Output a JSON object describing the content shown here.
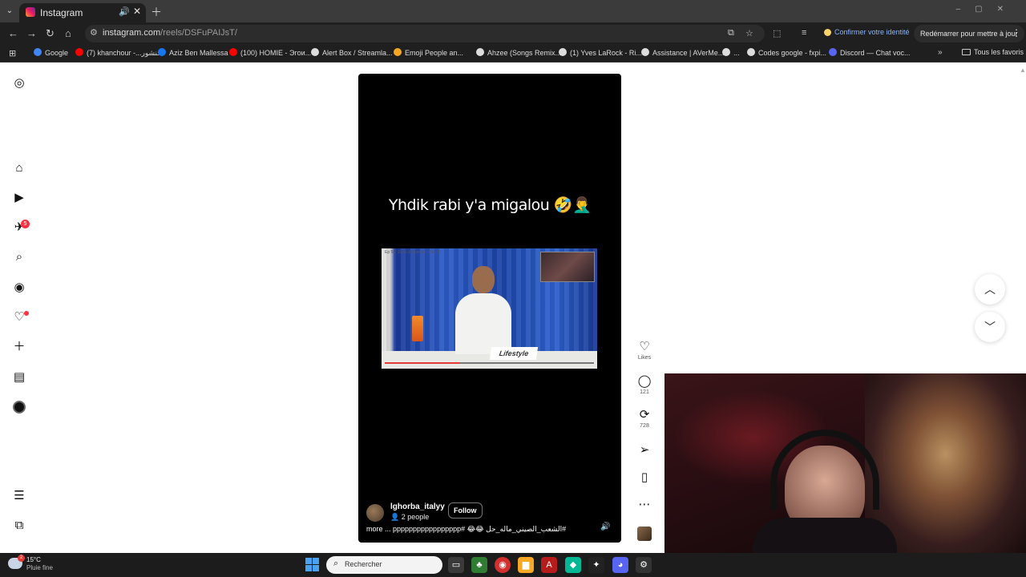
{
  "browser": {
    "tab_title": "Instagram",
    "url_host": "instagram.com",
    "url_path": "/reels/DSFuPAIJsT/",
    "confirm_identity": "Confirmer votre identité",
    "restart_label": "Redémarrer pour mettre à jour",
    "bookmarks": [
      {
        "label": "Google",
        "color": "#4285f4"
      },
      {
        "label": "(7) khanchour -...خنشور",
        "color": "#ff0000"
      },
      {
        "label": "Aziz Ben Mallessa",
        "color": "#1877f2"
      },
      {
        "label": "(100) HOMIE - Эгои...",
        "color": "#ff0000"
      },
      {
        "label": "Alert Box / Streamla...",
        "color": "#dddddd"
      },
      {
        "label": "Emoji People an...",
        "color": "#f5a623"
      },
      {
        "label": "Ahzee (Songs Remix...",
        "color": "#dddddd"
      },
      {
        "label": "(1) Yves LaRock - Ri...",
        "color": "#dddddd"
      },
      {
        "label": "Assistance | AVerMe...",
        "color": "#dddddd"
      },
      {
        "label": "...",
        "color": "#dddddd"
      },
      {
        "label": "Codes google - fxpi...",
        "color": "#dddddd"
      },
      {
        "label": "Discord — Chat voc...",
        "color": "#5865f2"
      }
    ],
    "all_bookmarks": "Tous les favoris"
  },
  "sidebar": {
    "notifications_badge": "5"
  },
  "reel": {
    "caption": "Yhdik rabi y'a migalou 🤣🤦‍♂️",
    "clip_tag": "Lifestyle",
    "clip_topline": "Ep 56: Zioss & Marwan (Part 1)",
    "username": "lghorba_italyy",
    "people": "2 people",
    "follow_label": "Follow",
    "description": "more ... ppppppppppppppppp# 😂😂 الشعب_الصيني_ماله_حل#"
  },
  "actions": {
    "likes_label": "Likes",
    "comments": "121",
    "reposts": "728"
  },
  "taskbar": {
    "temperature": "15°C",
    "weather_desc": "Pluie fine",
    "weather_badge": "2",
    "search_placeholder": "Rechercher"
  }
}
